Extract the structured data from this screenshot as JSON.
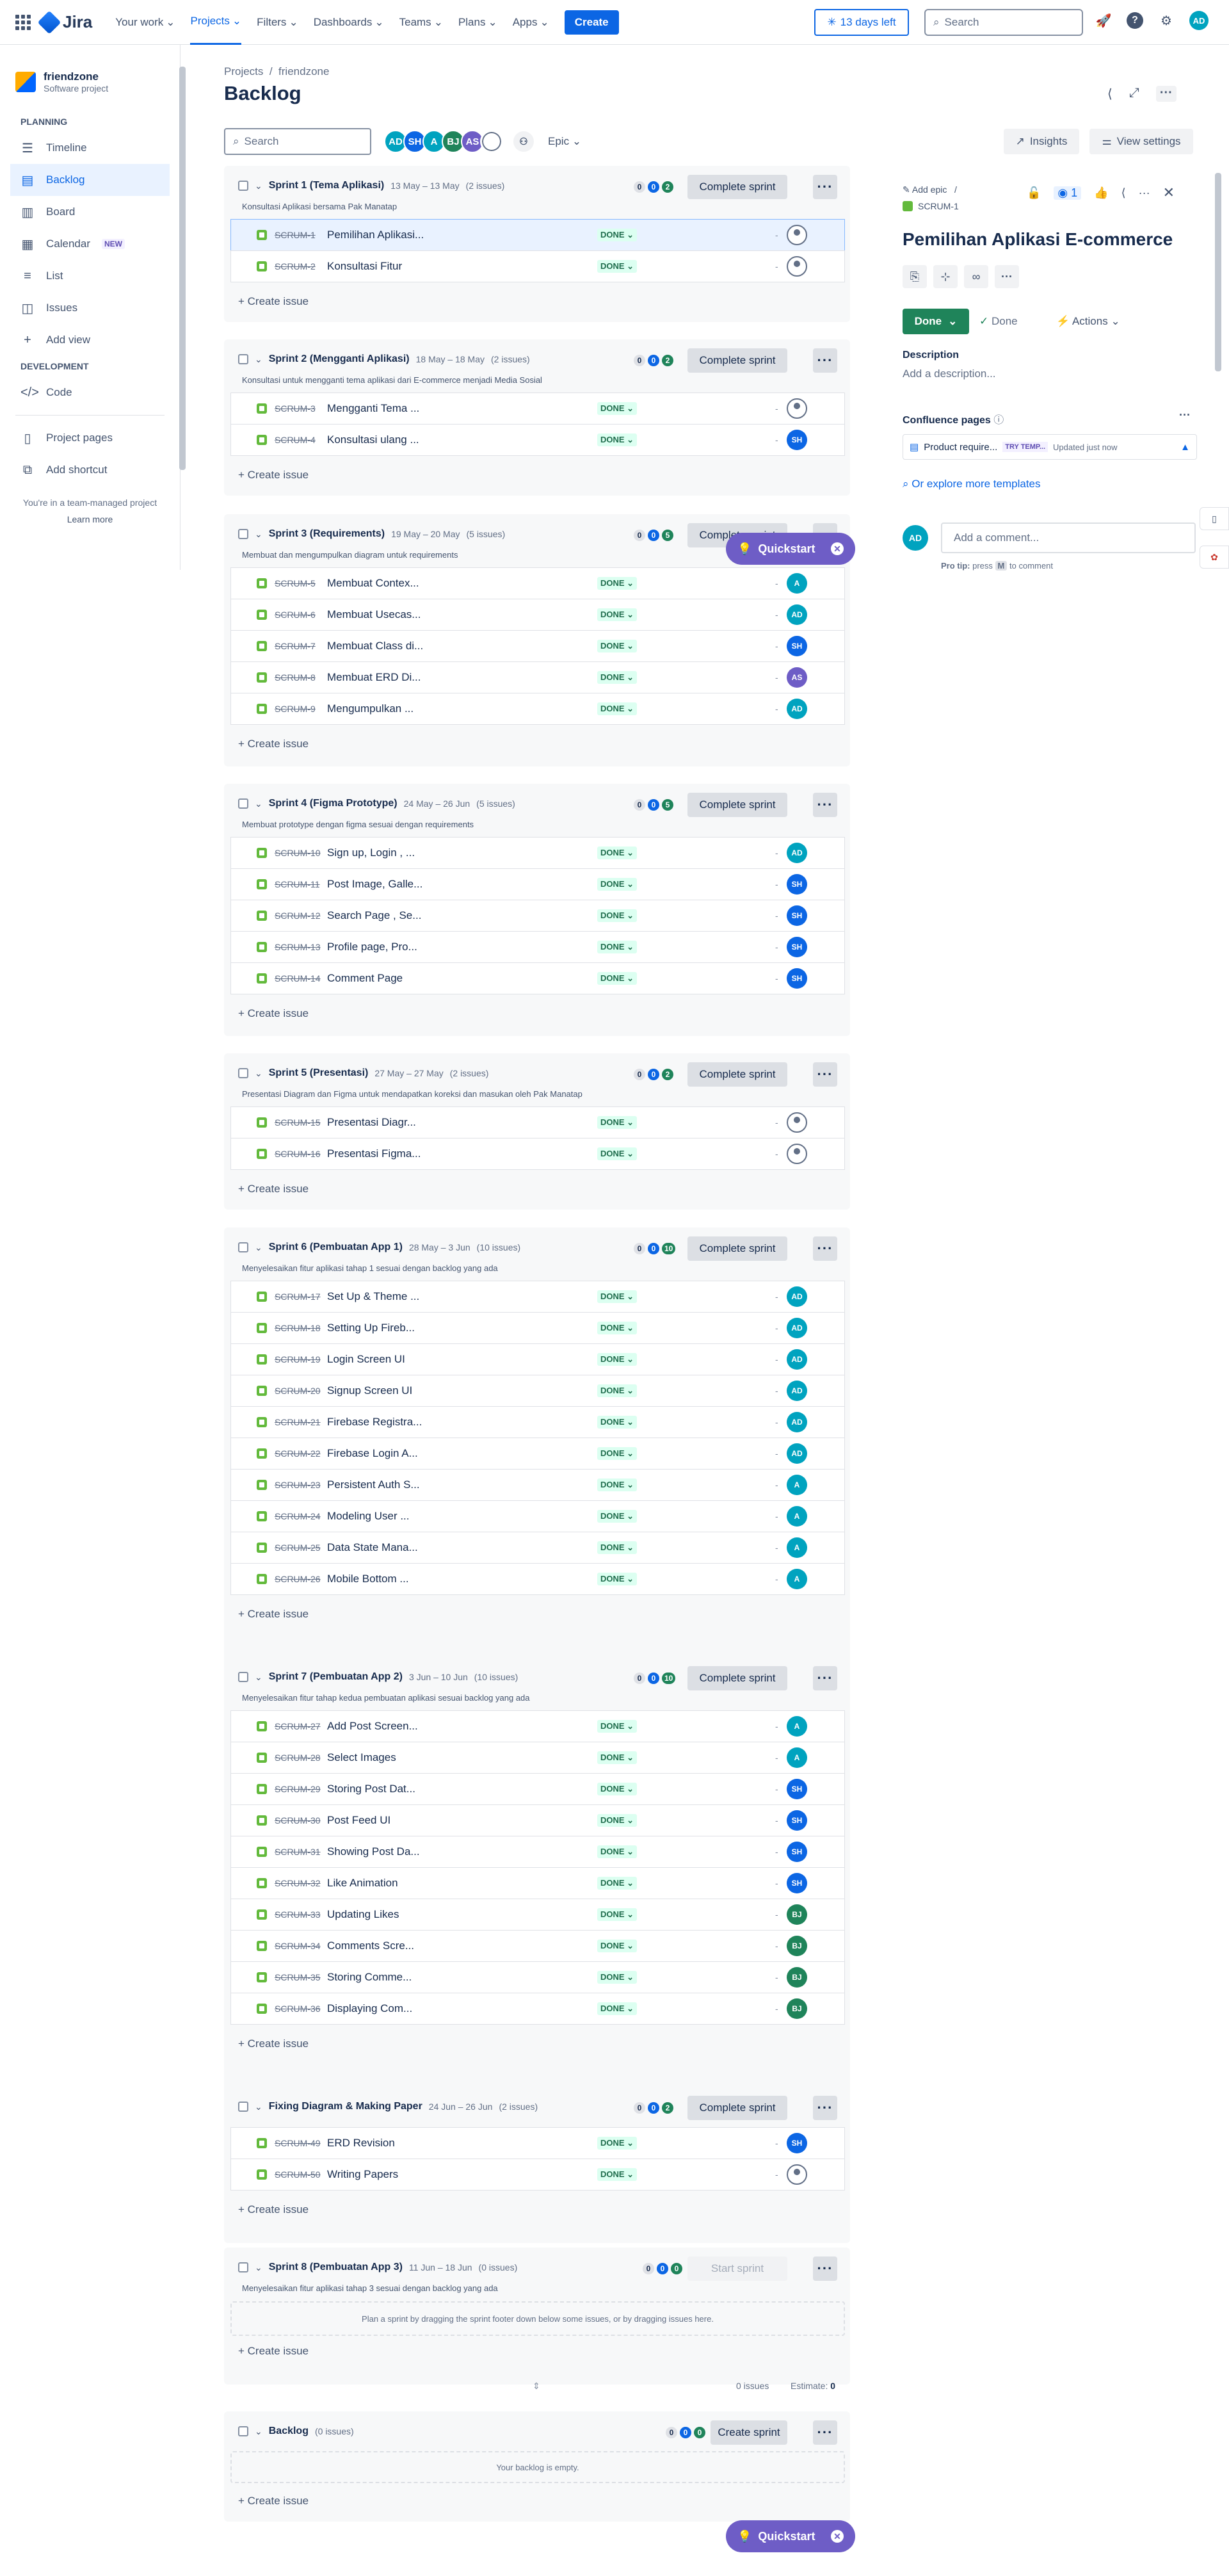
{
  "app": {
    "name": "Jira"
  },
  "nav": {
    "your_work": "Your work",
    "projects": "Projects",
    "filters": "Filters",
    "dashboards": "Dashboards",
    "teams": "Teams",
    "plans": "Plans",
    "apps": "Apps",
    "create": "Create",
    "trial": "13 days left",
    "search_placeholder": "Search",
    "user_initials": "AD"
  },
  "sidebar": {
    "project_name": "friendzone",
    "project_type": "Software project",
    "planning_heading": "PLANNING",
    "development_heading": "DEVELOPMENT",
    "items": [
      {
        "label": "Timeline",
        "icon": "timeline-icon"
      },
      {
        "label": "Backlog",
        "icon": "backlog-icon"
      },
      {
        "label": "Board",
        "icon": "board-icon"
      },
      {
        "label": "Calendar",
        "icon": "calendar-icon",
        "badge": "NEW"
      },
      {
        "label": "List",
        "icon": "list-icon"
      },
      {
        "label": "Issues",
        "icon": "issues-icon"
      },
      {
        "label": "Add view",
        "icon": "plus-icon"
      }
    ],
    "dev_items": [
      {
        "label": "Code",
        "icon": "code-icon"
      }
    ],
    "bottom_items": [
      {
        "label": "Project pages",
        "icon": "pages-icon"
      },
      {
        "label": "Add shortcut",
        "icon": "shortcut-icon"
      }
    ],
    "footer_text": "You're in a team-managed project",
    "learn_more": "Learn more"
  },
  "page": {
    "breadcrumb_projects": "Projects",
    "breadcrumb_project": "friendzone",
    "title": "Backlog",
    "search_placeholder": "Search",
    "epic_filter": "Epic",
    "insights": "Insights",
    "view_settings": "View settings"
  },
  "avatars": [
    {
      "initials": "AD",
      "color": "#00a3bf"
    },
    {
      "initials": "SH",
      "color": "#0c66e4"
    },
    {
      "initials": "A",
      "color": "#00a3bf"
    },
    {
      "initials": "BJ",
      "color": "#1f845a"
    },
    {
      "initials": "AS",
      "color": "#6e5dc6"
    },
    {
      "initials": "",
      "color": "#626f86"
    }
  ],
  "sprints": [
    {
      "name": "Sprint 1 (Tema Aplikasi)",
      "dates": "13 May – 13 May",
      "count": "(2 issues)",
      "goal": "Konsultasi Aplikasi bersama Pak Manatap",
      "c": [
        "0",
        "0",
        "2"
      ],
      "action": "Complete sprint",
      "issues": [
        [
          "SCRUM-1",
          "Pemilihan Aplikasi...",
          ""
        ],
        [
          "SCRUM-2",
          "Konsultasi Fitur",
          ""
        ]
      ]
    },
    {
      "name": "Sprint 2 (Mengganti Aplikasi)",
      "dates": "18 May – 18 May",
      "count": "(2 issues)",
      "goal": "Konsultasi untuk mengganti tema aplikasi dari E-commerce menjadi Media Sosial",
      "c": [
        "0",
        "0",
        "2"
      ],
      "action": "Complete sprint",
      "issues": [
        [
          "SCRUM-3",
          "Mengganti Tema ...",
          ""
        ],
        [
          "SCRUM-4",
          "Konsultasi ulang ...",
          "SH"
        ]
      ]
    },
    {
      "name": "Sprint 3 (Requirements)",
      "dates": "19 May – 20 May",
      "count": "(5 issues)",
      "goal": "Membuat dan mengumpulkan diagram untuk requirements",
      "c": [
        "0",
        "0",
        "5"
      ],
      "action": "Complete sprint",
      "issues": [
        [
          "SCRUM-5",
          "Membuat Contex...",
          "A"
        ],
        [
          "SCRUM-6",
          "Membuat Usecas...",
          "AD"
        ],
        [
          "SCRUM-7",
          "Membuat Class di...",
          "SH"
        ],
        [
          "SCRUM-8",
          "Membuat ERD Di...",
          "AS"
        ],
        [
          "SCRUM-9",
          "Mengumpulkan ...",
          "AD"
        ]
      ]
    },
    {
      "name": "Sprint 4 (Figma Prototype)",
      "dates": "24 May – 26 Jun",
      "count": "(5 issues)",
      "goal": "Membuat prototype dengan figma sesuai dengan requirements",
      "c": [
        "0",
        "0",
        "5"
      ],
      "action": "Complete sprint",
      "issues": [
        [
          "SCRUM-10",
          "Sign up, Login , ...",
          "AD"
        ],
        [
          "SCRUM-11",
          "Post Image, Galle...",
          "SH"
        ],
        [
          "SCRUM-12",
          "Search Page , Se...",
          "SH"
        ],
        [
          "SCRUM-13",
          "Profile page, Pro...",
          "SH"
        ],
        [
          "SCRUM-14",
          "Comment Page",
          "SH"
        ]
      ]
    },
    {
      "name": "Sprint 5 (Presentasi)",
      "dates": "27 May – 27 May",
      "count": "(2 issues)",
      "goal": "Presentasi Diagram dan Figma untuk mendapatkan koreksi dan masukan oleh Pak Manatap",
      "c": [
        "0",
        "0",
        "2"
      ],
      "action": "Complete sprint",
      "issues": [
        [
          "SCRUM-15",
          "Presentasi Diagr...",
          ""
        ],
        [
          "SCRUM-16",
          "Presentasi Figma...",
          ""
        ]
      ]
    },
    {
      "name": "Sprint 6 (Pembuatan App 1)",
      "dates": "28 May – 3 Jun",
      "count": "(10 issues)",
      "goal": "Menyelesaikan fitur aplikasi tahap 1 sesuai dengan backlog yang ada",
      "c": [
        "0",
        "0",
        "10"
      ],
      "action": "Complete sprint",
      "issues": [
        [
          "SCRUM-17",
          "Set Up & Theme ...",
          "AD"
        ],
        [
          "SCRUM-18",
          "Setting Up Fireb...",
          "AD"
        ],
        [
          "SCRUM-19",
          "Login Screen UI",
          "AD"
        ],
        [
          "SCRUM-20",
          "Signup Screen UI",
          "AD"
        ],
        [
          "SCRUM-21",
          "Firebase Registra...",
          "AD"
        ],
        [
          "SCRUM-22",
          "Firebase Login A...",
          "AD"
        ],
        [
          "SCRUM-23",
          "Persistent Auth S...",
          "A"
        ],
        [
          "SCRUM-24",
          "Modeling User ...",
          "A"
        ],
        [
          "SCRUM-25",
          "Data State Mana...",
          "A"
        ],
        [
          "SCRUM-26",
          "Mobile Bottom ...",
          "A"
        ]
      ]
    },
    {
      "name": "Sprint 7 (Pembuatan App 2)",
      "dates": "3 Jun – 10 Jun",
      "count": "(10 issues)",
      "goal": "Menyelesaikan fitur tahap kedua pembuatan aplikasi sesuai backlog yang ada",
      "c": [
        "0",
        "0",
        "10"
      ],
      "action": "Complete sprint",
      "issues": [
        [
          "SCRUM-27",
          "Add Post Screen...",
          "A"
        ],
        [
          "SCRUM-28",
          "Select Images",
          "A"
        ],
        [
          "SCRUM-29",
          "Storing Post Dat...",
          "SH"
        ],
        [
          "SCRUM-30",
          "Post Feed UI",
          "SH"
        ],
        [
          "SCRUM-31",
          "Showing Post Da...",
          "SH"
        ],
        [
          "SCRUM-32",
          "Like Animation",
          "SH"
        ],
        [
          "SCRUM-33",
          "Updating Likes",
          "BJ"
        ],
        [
          "SCRUM-34",
          "Comments Scre...",
          "BJ"
        ],
        [
          "SCRUM-35",
          "Storing Comme...",
          "BJ"
        ],
        [
          "SCRUM-36",
          "Displaying Com...",
          "BJ"
        ]
      ]
    },
    {
      "name": "Fixing Diagram & Making Paper",
      "dates": "24 Jun – 26 Jun",
      "count": "(2 issues)",
      "goal": "",
      "c": [
        "0",
        "0",
        "2"
      ],
      "action": "Complete sprint",
      "issues": [
        [
          "SCRUM-49",
          "ERD Revision",
          "SH"
        ],
        [
          "SCRUM-50",
          "Writing Papers",
          ""
        ]
      ]
    },
    {
      "name": "Sprint 8 (Pembuatan App 3)",
      "dates": "11 Jun – 18 Jun",
      "count": "(0 issues)",
      "goal": "Menyelesaikan fitur aplikasi tahap 3 sesuai dengan backlog yang ada",
      "c": [
        "0",
        "0",
        "0"
      ],
      "action": "Start sprint",
      "empty": "Plan a sprint by dragging the sprint footer down below some issues, or by dragging issues here.",
      "issues": []
    }
  ],
  "status_done": "DONE",
  "create_issue": "+ Create issue",
  "summary": {
    "issues": "0 issues",
    "estimate_label": "Estimate:",
    "estimate": "0"
  },
  "backlog": {
    "name": "Backlog",
    "count": "(0 issues)",
    "c": [
      "0",
      "0",
      "0"
    ],
    "action": "Create sprint",
    "empty": "Your backlog is empty."
  },
  "quickstart": "Quickstart",
  "detail": {
    "add_epic": "Add epic",
    "key": "SCRUM-1",
    "watchers": "1",
    "title": "Pemilihan Aplikasi E-commerce",
    "status": "Done",
    "resolution": "Done",
    "actions": "Actions",
    "description_heading": "Description",
    "description_placeholder": "Add a description...",
    "confluence_heading": "Confluence pages",
    "confluence_page": "Product require...",
    "try_template": "TRY TEMP...",
    "updated": "Updated just now",
    "explore": "Or explore more templates",
    "comment_placeholder": "Add a comment...",
    "pro_tip": "Pro tip:",
    "pro_tip_rest": "press",
    "pro_tip_key": "M",
    "pro_tip_end": "to comment",
    "user_initials": "AD"
  },
  "colors": {
    "AD": "#00a3bf",
    "SH": "#0c66e4",
    "A": "#00a3bf",
    "AS": "#6e5dc6",
    "BJ": "#1f845a",
    "brand": "#0c66e4",
    "done": "#1f845a",
    "quickstart": "#6e5dc6"
  }
}
